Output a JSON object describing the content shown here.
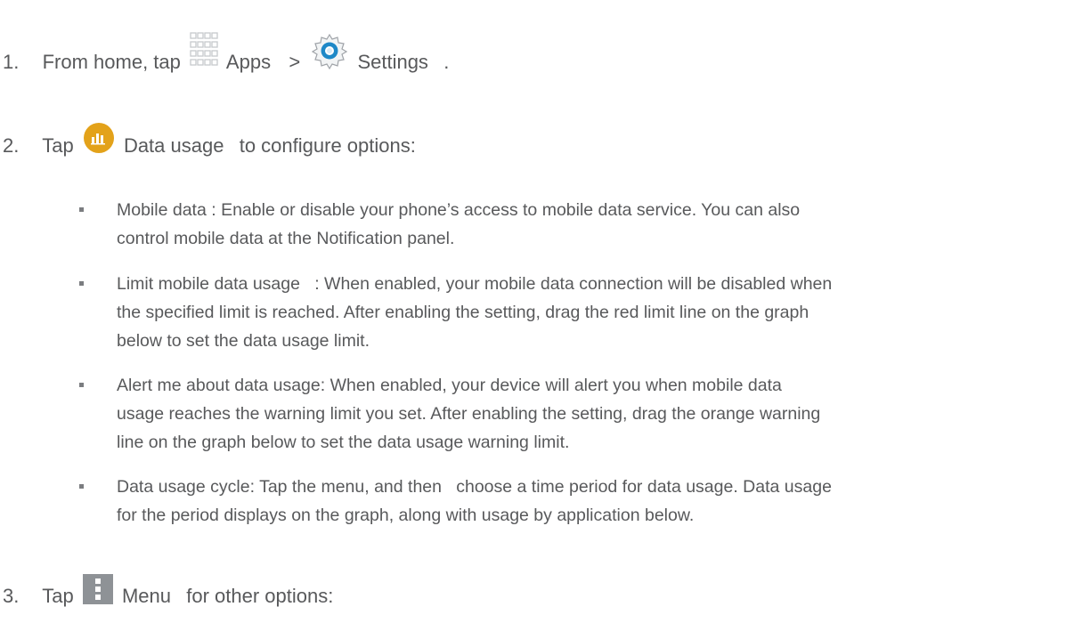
{
  "steps": {
    "step1": {
      "number": "1.",
      "prefix": "From home, tap",
      "apps_label": "Apps",
      "separator": ">",
      "settings_label": "Settings",
      "suffix": "."
    },
    "step2": {
      "number": "2.",
      "prefix": "Tap",
      "label": "Data usage",
      "suffix": "to configure options:"
    },
    "step3": {
      "number": "3.",
      "prefix": "Tap",
      "label": "Menu",
      "suffix": "for other options:"
    }
  },
  "bullets": [
    {
      "term": "Mobile data",
      "lines": [
        " : Enable or disable your phone’s access to mobile data service. You can also",
        "control mobile data at the Notification panel."
      ]
    },
    {
      "term": "Limit mobile data usage",
      "lines": [
        "   : When enabled, your mobile data connection will be disabled when",
        "the specified limit is reached. After enabling the setting, drag the red limit line on the graph",
        "below to set the data usage limit."
      ]
    },
    {
      "term": "Alert me about data usage",
      "lines": [
        ": When enabled, your device will alert you when mobile data",
        "usage reaches the warning limit you set. After enabling the setting, drag the orange warning",
        "line on the graph below to set the data usage warning limit."
      ]
    },
    {
      "term": "Data usage cycle",
      "lines": [
        ": Tap the menu, and then   choose a time period for data usage. Data usage",
        "for the period displays on the graph, along with usage by application below."
      ]
    }
  ],
  "colors": {
    "text": "#58595b",
    "apps_icon": "#c7c9cc",
    "settings_icon_blue": "#1e88c7",
    "data_usage_icon": "#e3a21a",
    "menu_icon": "#8e9296"
  },
  "icons": {
    "apps": "apps-grid-icon",
    "settings": "settings-gear-icon",
    "data_usage": "data-usage-icon",
    "menu": "menu-dots-icon"
  }
}
